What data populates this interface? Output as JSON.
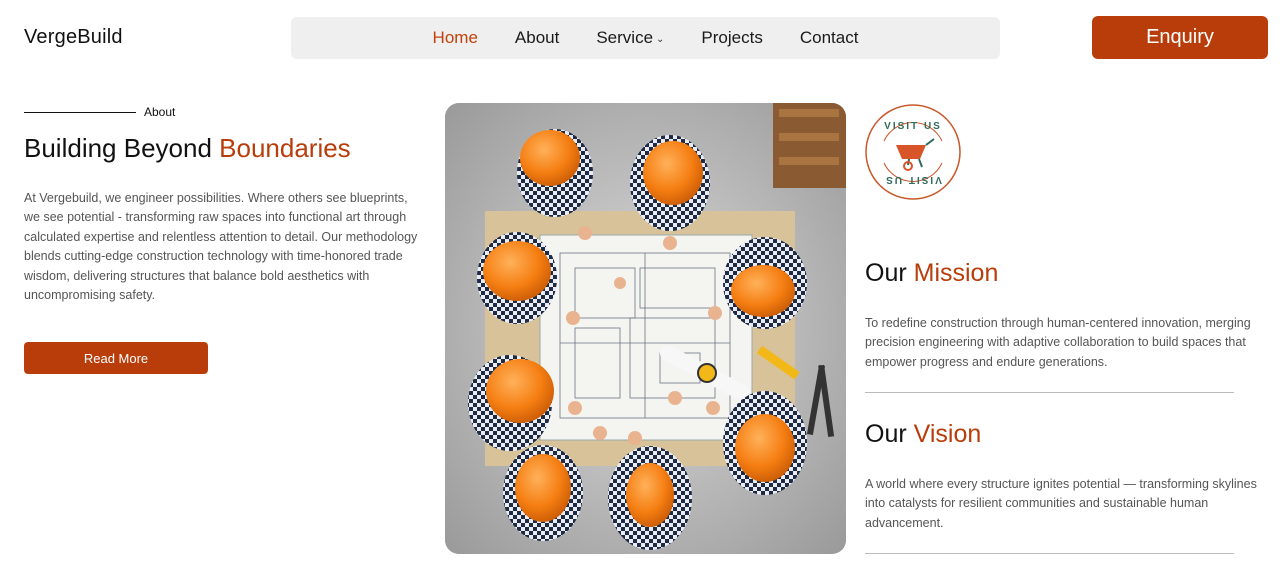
{
  "header": {
    "brand": "VergeBuild",
    "nav": [
      {
        "label": "Home",
        "active": true
      },
      {
        "label": "About"
      },
      {
        "label": "Service",
        "has_dropdown": true
      },
      {
        "label": "Projects"
      },
      {
        "label": "Contact"
      }
    ],
    "cta_label": "Enquiry"
  },
  "about": {
    "eyebrow": "About",
    "title_plain": "Building Beyond ",
    "title_accent": "Boundaries",
    "description": "At Vergebuild, we engineer possibilities. Where others see blueprints, we see potential - transforming raw spaces into functional art through calculated expertise and relentless attention to detail. Our methodology blends cutting-edge construction technology with time-honored trade wisdom, delivering structures that balance bold aesthetics with uncompromising safety.",
    "button_label": "Read More"
  },
  "badge": {
    "text": "VISIT US VISIT US",
    "icon": "wheelbarrow-icon"
  },
  "mission": {
    "title_plain": "Our ",
    "title_accent": "Mission",
    "description": "To redefine construction through human-centered innovation, merging precision engineering with adaptive collaboration to build spaces that empower progress and endure generations."
  },
  "vision": {
    "title_plain": "Our ",
    "title_accent": "Vision",
    "description": "A world where every structure ignites potential — transforming skylines into catalysts for resilient communities and sustainable human advancement."
  },
  "colors": {
    "accent": "#b83d0a",
    "nav_bg": "#efefef",
    "text_muted": "#555555"
  }
}
